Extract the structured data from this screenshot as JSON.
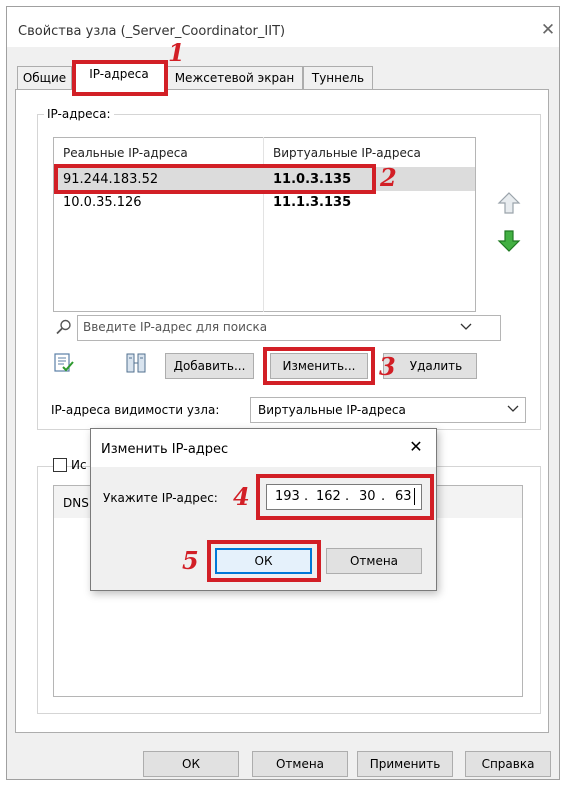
{
  "window": {
    "title": "Свойства узла (_Server_Coordinator_IIT)"
  },
  "tabs": [
    {
      "label": "Общие"
    },
    {
      "label": "IP-адреса"
    },
    {
      "label": "Межсетевой экран"
    },
    {
      "label": "Туннель"
    }
  ],
  "ip_group": {
    "label": "IP-адреса:",
    "columns": [
      "Реальные IP-адреса",
      "Виртуальные IP-адреса"
    ],
    "rows": [
      {
        "real": "91.244.183.52",
        "virtual": "11.0.3.135"
      },
      {
        "real": "10.0.35.126",
        "virtual": "11.1.3.135"
      }
    ],
    "search_placeholder": "Введите IP-адрес для поиска",
    "add_label": "Добавить...",
    "edit_label": "Изменить...",
    "delete_label": "Удалить",
    "visibility_label": "IP-адреса видимости узла:",
    "visibility_value": "Виртуальные IP-адреса"
  },
  "lower_group": {
    "checkbox_label_partial": "Ис",
    "list_partial": "DNS"
  },
  "dialog": {
    "title": "Изменить IP-адрес",
    "prompt": "Укажите IP-адрес:",
    "ip_octets": [
      "193",
      "162",
      "30",
      "63"
    ],
    "dot": ".",
    "ok_label": "ОК",
    "cancel_label": "Отмена"
  },
  "footer": {
    "ok_label": "ОК",
    "cancel_label": "Отмена",
    "apply_label": "Применить",
    "help_label": "Справка"
  },
  "annotations": [
    "1",
    "2",
    "3",
    "4",
    "5"
  ],
  "colors": {
    "annotation": "#d21f26",
    "arrow_up": "#b9c1c9",
    "arrow_down": "#3aa137"
  }
}
